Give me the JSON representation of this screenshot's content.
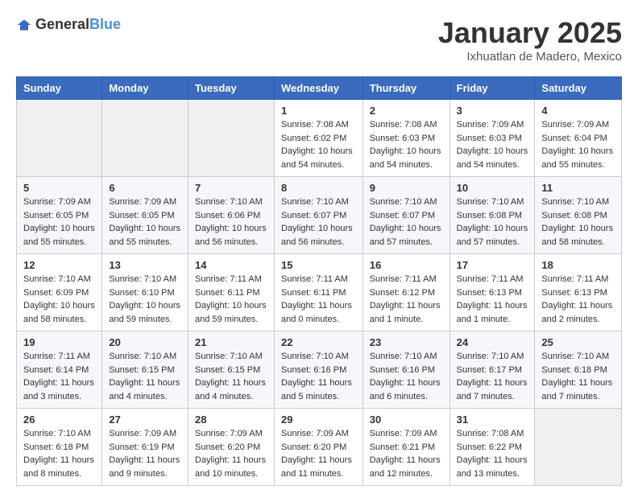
{
  "logo": {
    "general": "General",
    "blue": "Blue"
  },
  "header": {
    "month": "January 2025",
    "location": "Ixhuatlan de Madero, Mexico"
  },
  "weekdays": [
    "Sunday",
    "Monday",
    "Tuesday",
    "Wednesday",
    "Thursday",
    "Friday",
    "Saturday"
  ],
  "weeks": [
    [
      {
        "day": "",
        "info": ""
      },
      {
        "day": "",
        "info": ""
      },
      {
        "day": "",
        "info": ""
      },
      {
        "day": "1",
        "info": "Sunrise: 7:08 AM\nSunset: 6:02 PM\nDaylight: 10 hours\nand 54 minutes."
      },
      {
        "day": "2",
        "info": "Sunrise: 7:08 AM\nSunset: 6:03 PM\nDaylight: 10 hours\nand 54 minutes."
      },
      {
        "day": "3",
        "info": "Sunrise: 7:09 AM\nSunset: 6:03 PM\nDaylight: 10 hours\nand 54 minutes."
      },
      {
        "day": "4",
        "info": "Sunrise: 7:09 AM\nSunset: 6:04 PM\nDaylight: 10 hours\nand 55 minutes."
      }
    ],
    [
      {
        "day": "5",
        "info": "Sunrise: 7:09 AM\nSunset: 6:05 PM\nDaylight: 10 hours\nand 55 minutes."
      },
      {
        "day": "6",
        "info": "Sunrise: 7:09 AM\nSunset: 6:05 PM\nDaylight: 10 hours\nand 55 minutes."
      },
      {
        "day": "7",
        "info": "Sunrise: 7:10 AM\nSunset: 6:06 PM\nDaylight: 10 hours\nand 56 minutes."
      },
      {
        "day": "8",
        "info": "Sunrise: 7:10 AM\nSunset: 6:07 PM\nDaylight: 10 hours\nand 56 minutes."
      },
      {
        "day": "9",
        "info": "Sunrise: 7:10 AM\nSunset: 6:07 PM\nDaylight: 10 hours\nand 57 minutes."
      },
      {
        "day": "10",
        "info": "Sunrise: 7:10 AM\nSunset: 6:08 PM\nDaylight: 10 hours\nand 57 minutes."
      },
      {
        "day": "11",
        "info": "Sunrise: 7:10 AM\nSunset: 6:08 PM\nDaylight: 10 hours\nand 58 minutes."
      }
    ],
    [
      {
        "day": "12",
        "info": "Sunrise: 7:10 AM\nSunset: 6:09 PM\nDaylight: 10 hours\nand 58 minutes."
      },
      {
        "day": "13",
        "info": "Sunrise: 7:10 AM\nSunset: 6:10 PM\nDaylight: 10 hours\nand 59 minutes."
      },
      {
        "day": "14",
        "info": "Sunrise: 7:11 AM\nSunset: 6:11 PM\nDaylight: 10 hours\nand 59 minutes."
      },
      {
        "day": "15",
        "info": "Sunrise: 7:11 AM\nSunset: 6:11 PM\nDaylight: 11 hours\nand 0 minutes."
      },
      {
        "day": "16",
        "info": "Sunrise: 7:11 AM\nSunset: 6:12 PM\nDaylight: 11 hours\nand 1 minute."
      },
      {
        "day": "17",
        "info": "Sunrise: 7:11 AM\nSunset: 6:13 PM\nDaylight: 11 hours\nand 1 minute."
      },
      {
        "day": "18",
        "info": "Sunrise: 7:11 AM\nSunset: 6:13 PM\nDaylight: 11 hours\nand 2 minutes."
      }
    ],
    [
      {
        "day": "19",
        "info": "Sunrise: 7:11 AM\nSunset: 6:14 PM\nDaylight: 11 hours\nand 3 minutes."
      },
      {
        "day": "20",
        "info": "Sunrise: 7:10 AM\nSunset: 6:15 PM\nDaylight: 11 hours\nand 4 minutes."
      },
      {
        "day": "21",
        "info": "Sunrise: 7:10 AM\nSunset: 6:15 PM\nDaylight: 11 hours\nand 4 minutes."
      },
      {
        "day": "22",
        "info": "Sunrise: 7:10 AM\nSunset: 6:16 PM\nDaylight: 11 hours\nand 5 minutes."
      },
      {
        "day": "23",
        "info": "Sunrise: 7:10 AM\nSunset: 6:16 PM\nDaylight: 11 hours\nand 6 minutes."
      },
      {
        "day": "24",
        "info": "Sunrise: 7:10 AM\nSunset: 6:17 PM\nDaylight: 11 hours\nand 7 minutes."
      },
      {
        "day": "25",
        "info": "Sunrise: 7:10 AM\nSunset: 6:18 PM\nDaylight: 11 hours\nand 7 minutes."
      }
    ],
    [
      {
        "day": "26",
        "info": "Sunrise: 7:10 AM\nSunset: 6:18 PM\nDaylight: 11 hours\nand 8 minutes."
      },
      {
        "day": "27",
        "info": "Sunrise: 7:09 AM\nSunset: 6:19 PM\nDaylight: 11 hours\nand 9 minutes."
      },
      {
        "day": "28",
        "info": "Sunrise: 7:09 AM\nSunset: 6:20 PM\nDaylight: 11 hours\nand 10 minutes."
      },
      {
        "day": "29",
        "info": "Sunrise: 7:09 AM\nSunset: 6:20 PM\nDaylight: 11 hours\nand 11 minutes."
      },
      {
        "day": "30",
        "info": "Sunrise: 7:09 AM\nSunset: 6:21 PM\nDaylight: 11 hours\nand 12 minutes."
      },
      {
        "day": "31",
        "info": "Sunrise: 7:08 AM\nSunset: 6:22 PM\nDaylight: 11 hours\nand 13 minutes."
      },
      {
        "day": "",
        "info": ""
      }
    ]
  ]
}
